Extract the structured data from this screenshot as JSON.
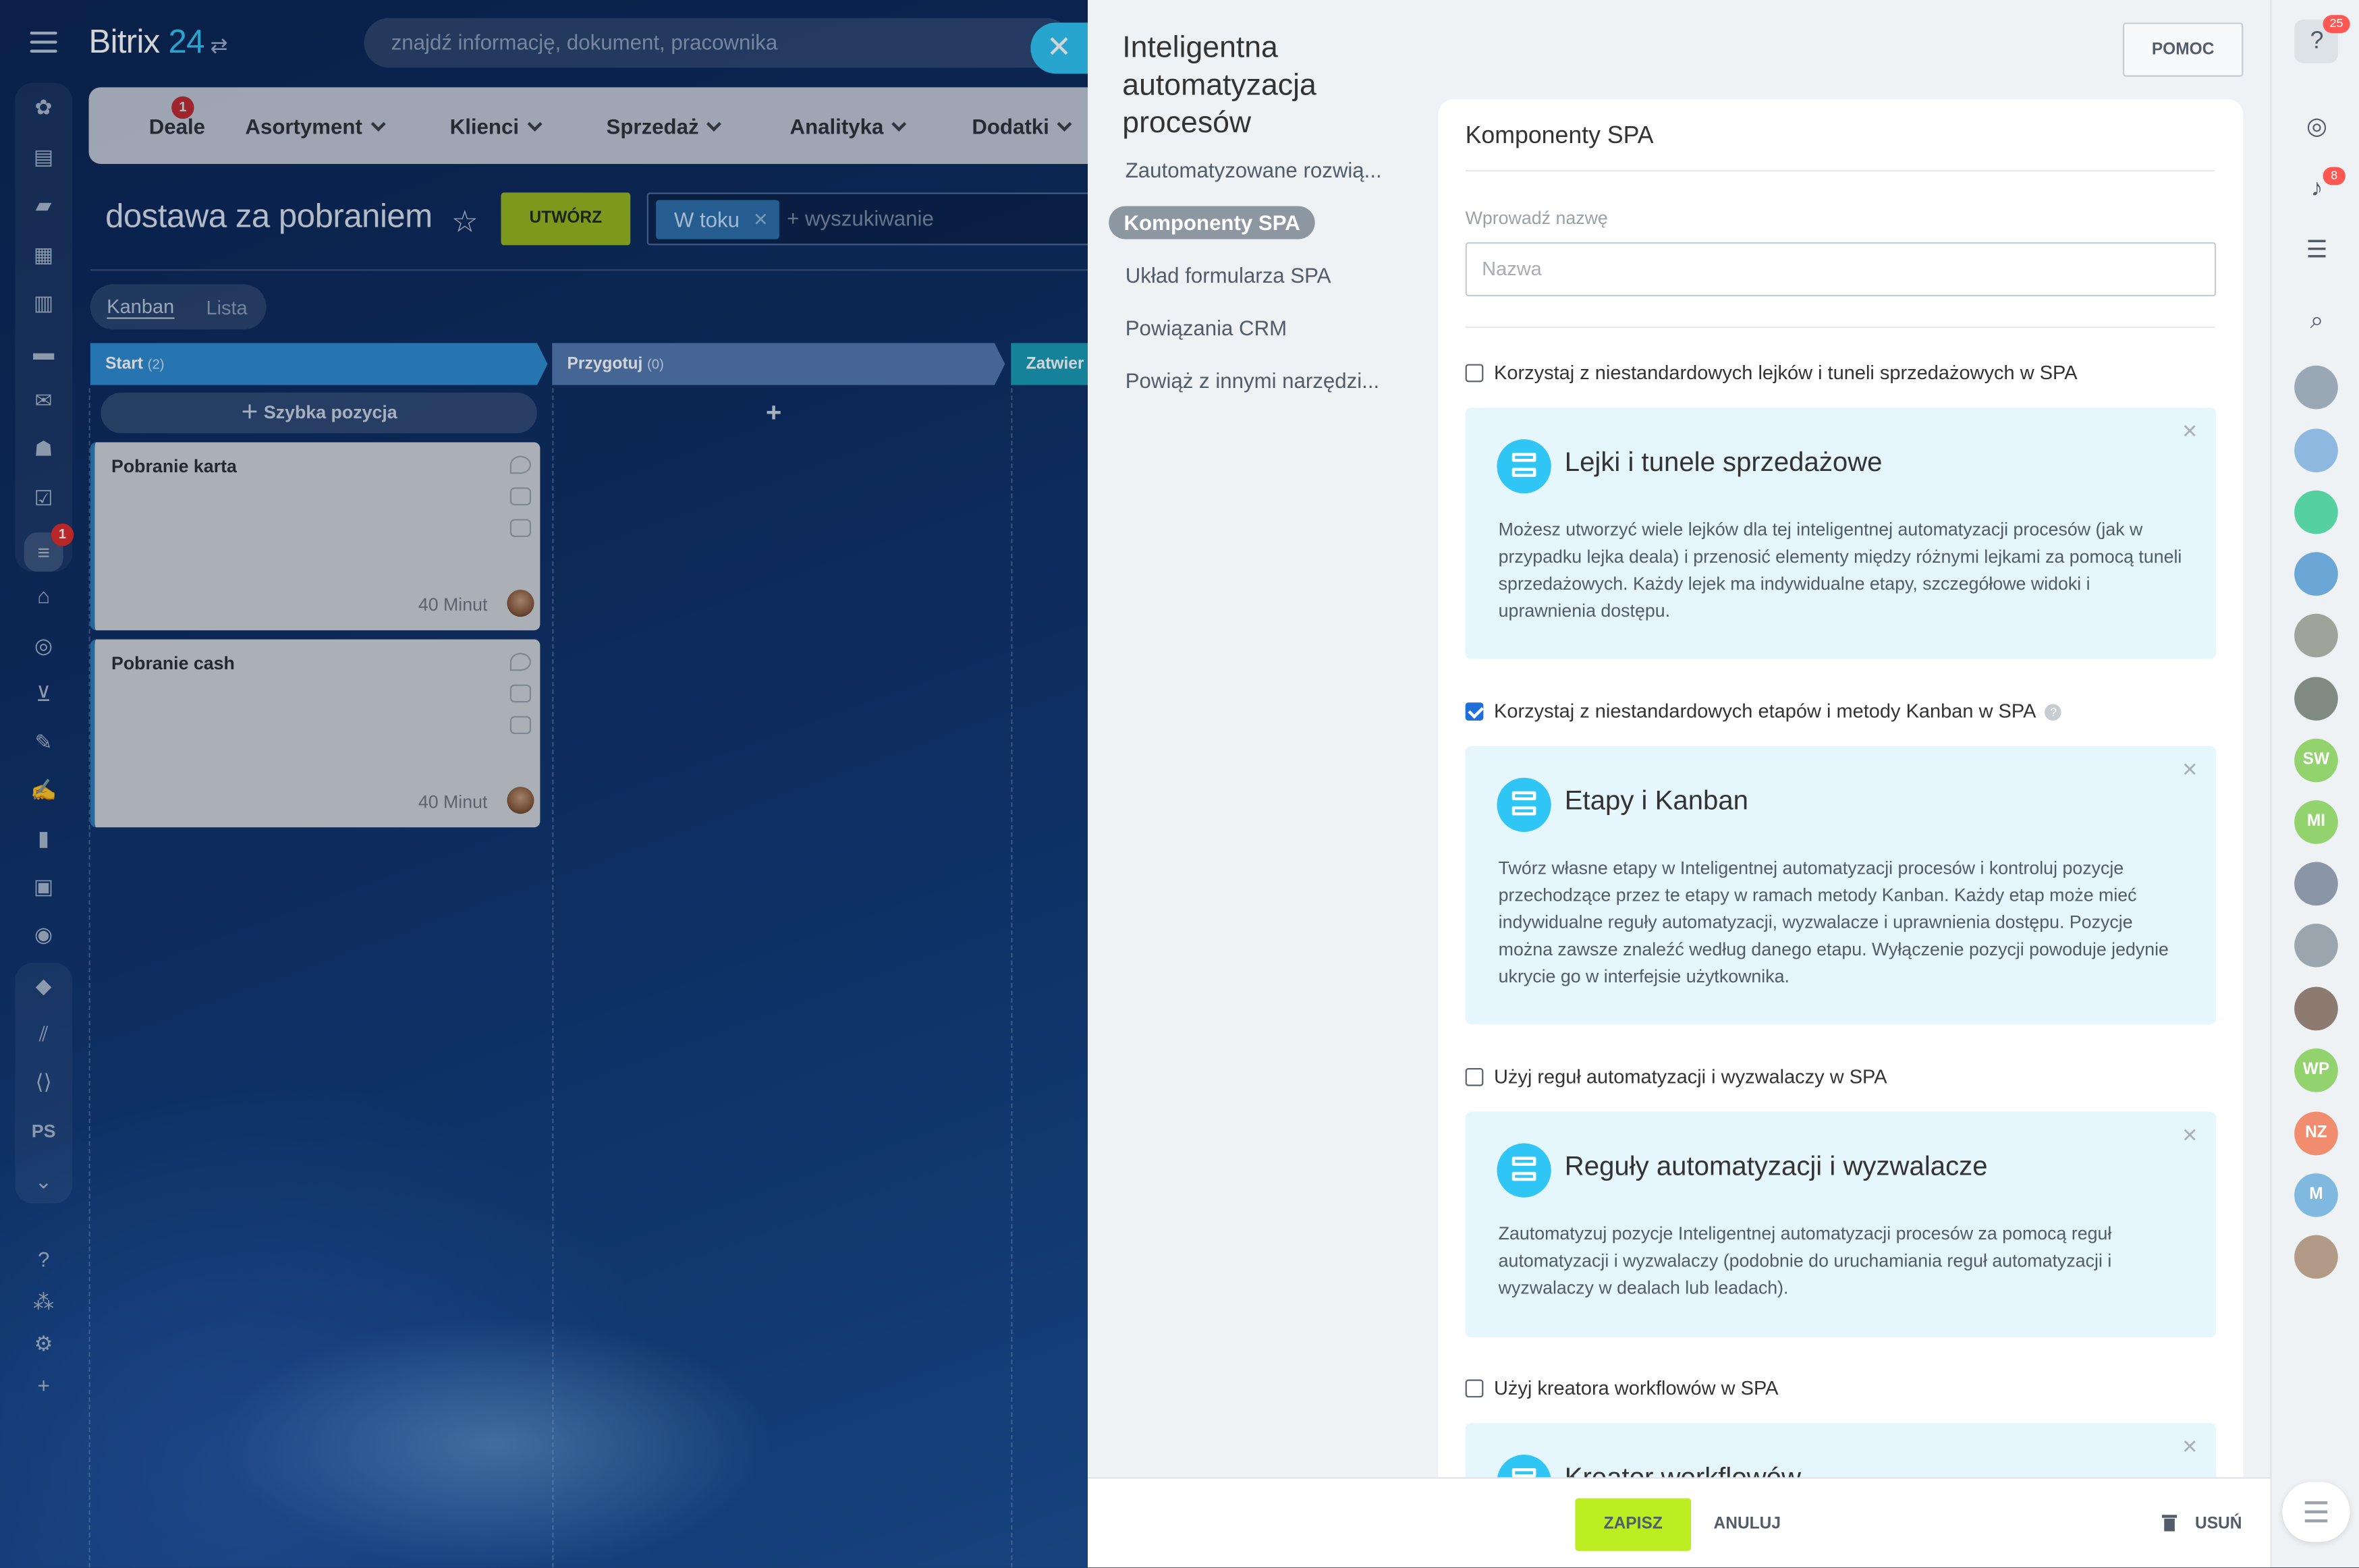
{
  "app": {
    "logo_text": "Bitrix",
    "logo_number": "24"
  },
  "search": {
    "placeholder": "znajdź informację, dokument, pracownika"
  },
  "rail": {
    "badge": "1",
    "ps_label": "PS"
  },
  "menu": {
    "items": [
      "Deale",
      "Asortyment",
      "Klienci",
      "Sprzedaż",
      "Analityka",
      "Dodatki"
    ],
    "deale_badge": "1"
  },
  "page": {
    "title": "dostawa za pobraniem",
    "create_label": "UTWÓRZ",
    "filter_tag": "W toku",
    "filter_placeholder": "+ wyszukiwanie"
  },
  "view": {
    "kanban": "Kanban",
    "list": "Lista"
  },
  "columns": [
    {
      "name": "Start",
      "count": "(2)",
      "color": "#2e8ad1"
    },
    {
      "name": "Przygotuj",
      "count": "(0)",
      "color": "#5378b0"
    },
    {
      "name": "Zatwier",
      "count": "",
      "color": "#1a9bb5"
    }
  ],
  "quick_add": "Szybka pozycja",
  "cards": [
    {
      "title": "Pobranie karta",
      "time": "40 Minut"
    },
    {
      "title": "Pobranie cash",
      "time": "40 Minut"
    }
  ],
  "panel": {
    "title": "Inteligentna automatyzacja procesów",
    "help_button": "POMOC",
    "nav": [
      "Zautomatyzowane rozwią...",
      "Komponenty SPA",
      "Układ formularza SPA",
      "Powiązania CRM",
      "Powiąż z innymi narzędzi..."
    ],
    "section_title": "Komponenty SPA",
    "name_label": "Wprowadź nazwę",
    "name_placeholder": "Nazwa",
    "options": [
      {
        "label": "Korzystaj z niestandardowych lejków i tuneli sprzedażowych w SPA",
        "checked": false,
        "box_title": "Lejki i tunele sprzedażowe",
        "box_text": "Możesz utworzyć wiele lejków dla tej inteligentnej automatyzacji procesów (jak w przypadku lejka deala) i przenosić elementy między różnymi lejkami za pomocą tuneli sprzedażowych. Każdy lejek ma indywidualne etapy, szczegółowe widoki i uprawnienia dostępu."
      },
      {
        "label": "Korzystaj z niestandardowych etapów i metody Kanban w SPA",
        "checked": true,
        "box_title": "Etapy i Kanban",
        "box_text": "Twórz własne etapy w Inteligentnej automatyzacji procesów i kontroluj pozycje przechodzące przez te etapy w ramach metody Kanban. Każdy etap może mieć indywidualne reguły automatyzacji, wyzwalacze i uprawnienia dostępu. Pozycje można zawsze znaleźć według danego etapu. Wyłączenie pozycji powoduje jedynie ukrycie go w interfejsie użytkownika."
      },
      {
        "label": "Użyj reguł automatyzacji i wyzwalaczy w SPA",
        "checked": false,
        "box_title": "Reguły automatyzacji i wyzwalacze",
        "box_text": "Zautomatyzuj pozycje Inteligentnej automatyzacji procesów za pomocą reguł automatyzacji i wyzwalaczy (podobnie do uruchamiania reguł automatyzacji i wyzwalaczy w dealach lub leadach)."
      },
      {
        "label": "Użyj kreatora workflowów w SPA",
        "checked": false,
        "box_title": "Kreator workflowów",
        "box_text": ""
      }
    ],
    "footer": {
      "save": "ZAPISZ",
      "cancel": "ANULUJ",
      "delete": "USUŃ"
    }
  },
  "right_rail": {
    "help_badge": "25",
    "bell_badge": "8",
    "avatars": [
      "SW",
      "MI",
      "WP",
      "NZ",
      "M"
    ]
  }
}
